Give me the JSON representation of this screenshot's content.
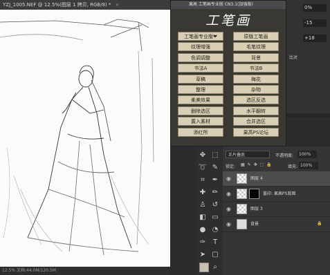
{
  "document": {
    "tab_title": "YZJ_1005.NEF @ 12.5%(图层 1 拷贝, RGB/8) *",
    "close": "×",
    "status": "12.5%  文档:44.0M/120.5M"
  },
  "plugin": {
    "title": "果高 工笔画专业版 CN3.1(加强版)",
    "logo": "工笔画",
    "left_buttons": [
      "工笔画专业版❤",
      "纹理增强",
      "色调调整",
      "书法A",
      "草稿",
      "整理",
      "柔美效果",
      "删除选区",
      "置入素材",
      "添红所"
    ],
    "right_buttons": [
      "原版工笔画",
      "毛笔纹理",
      "背景",
      "书法B",
      "梅花",
      "杂物",
      "选区反选",
      "水平翻转",
      "合并选区",
      "果高PS论坛"
    ]
  },
  "options_panel": {
    "rows": [
      {
        "label": "",
        "value": "0%"
      },
      {
        "label": "",
        "value": "-15"
      },
      {
        "label": "",
        "value": "+18"
      }
    ],
    "link_label": "比对"
  },
  "layers_panel": {
    "blend_mode": "正片叠底",
    "opacity_label": "不透明度:",
    "opacity_value": "100%",
    "lock_label": "锁定:",
    "fill_label": "填充:",
    "fill_value": "100%",
    "layers": [
      {
        "name": "图层 4",
        "selected": true
      },
      {
        "name": "盖印: 果高PS底图",
        "selected": false
      },
      {
        "name": "图层 3",
        "selected": false
      },
      {
        "name": "背景",
        "selected": false
      }
    ]
  },
  "tools": {
    "items": [
      "move-icon",
      "marquee-icon",
      "lasso-icon",
      "quick-select-icon",
      "crop-icon",
      "eyedropper-icon",
      "healing-icon",
      "brush-icon",
      "stamp-icon",
      "history-brush-icon",
      "eraser-icon",
      "gradient-icon",
      "blur-icon",
      "dodge-icon",
      "pen-icon",
      "type-icon",
      "path-select-icon",
      "shape-icon",
      "hand-icon",
      "zoom-icon"
    ]
  }
}
